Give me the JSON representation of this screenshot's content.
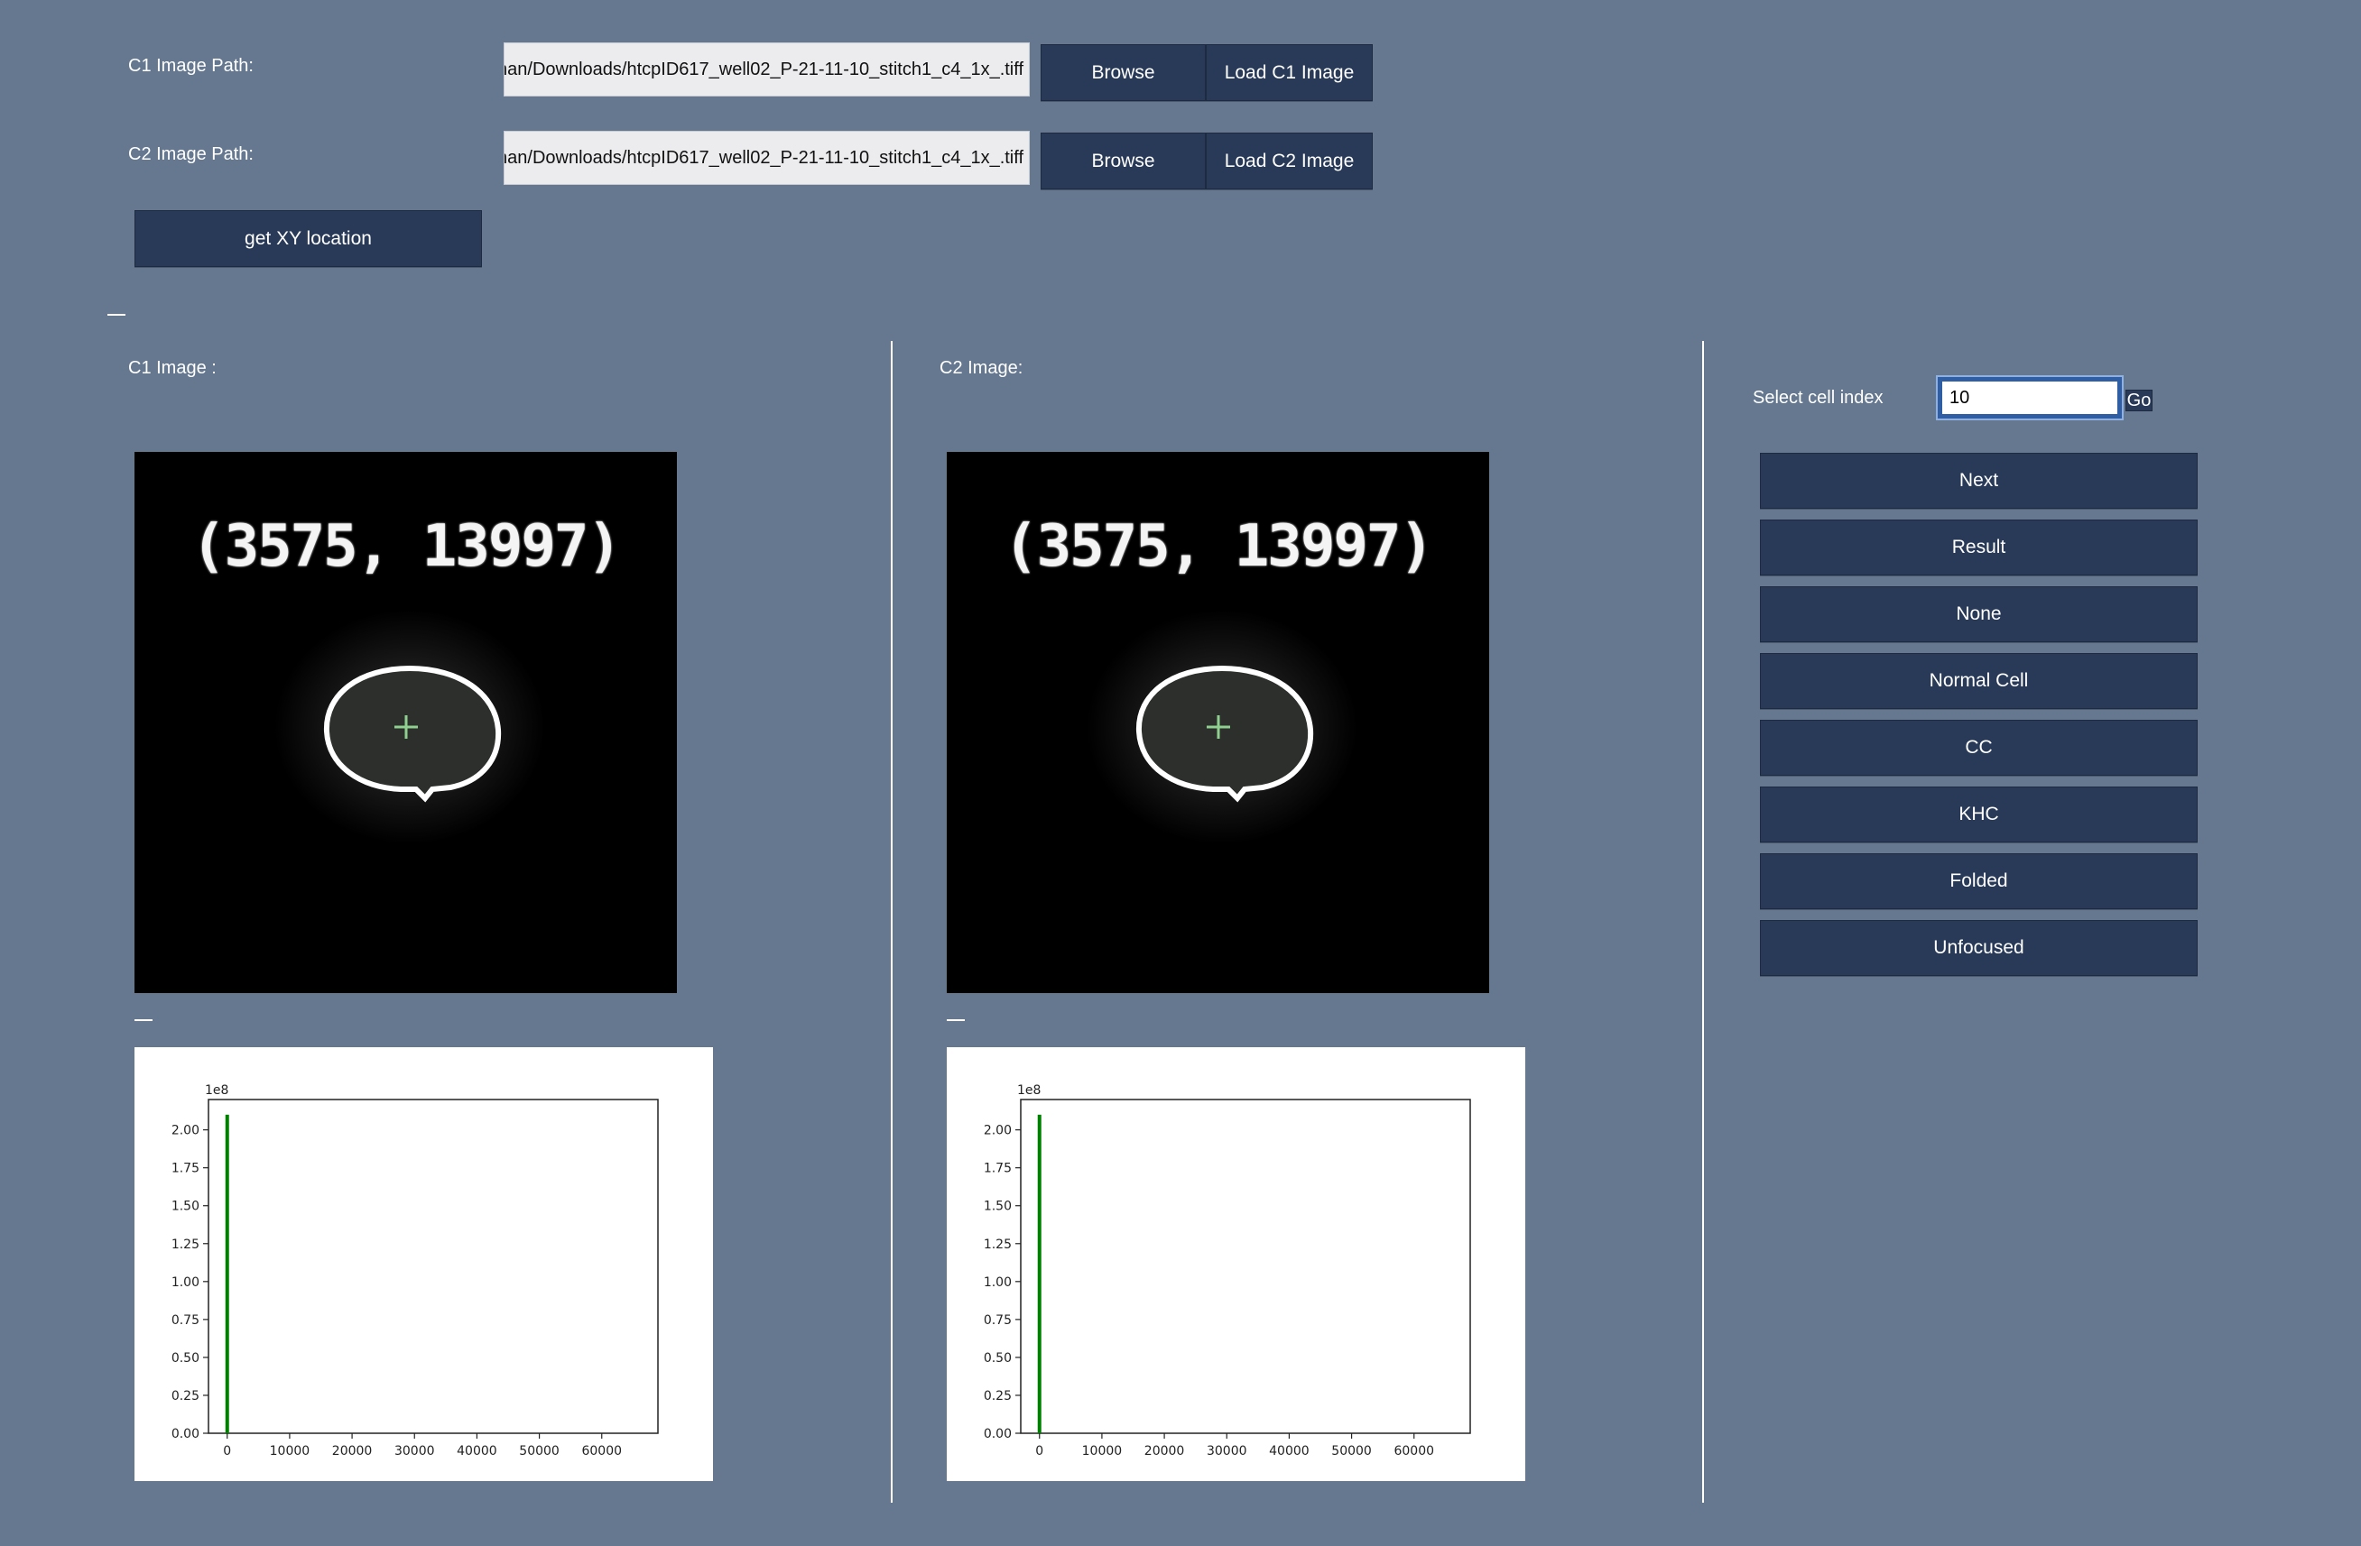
{
  "paths": {
    "c1_label": "C1 Image Path:",
    "c1_value": "nan/Downloads/htcpID617_well02_P-21-11-10_stitch1_c4_1x_.tiff",
    "c2_label": "C2 Image Path:",
    "c2_value": "nan/Downloads/htcpID617_well02_P-21-11-10_stitch1_c4_1x_.tiff",
    "browse_label": "Browse",
    "load_c1_label": "Load C1 Image",
    "load_c2_label": "Load C2 Image",
    "xy_button_label": "get XY location"
  },
  "viewers": {
    "c1_title": "C1 Image :",
    "c2_title": "C2 Image:",
    "coord_text": "(3575, 13997)"
  },
  "side_panel": {
    "select_label": "Select cell index",
    "index_value": "10",
    "go_label": "Go",
    "buttons": [
      "Next",
      "Result",
      "None",
      "Normal Cell",
      "CC",
      "KHC",
      "Folded",
      "Unfocused"
    ]
  },
  "chart_data": [
    {
      "type": "bar",
      "name": "c1-histogram",
      "title": "",
      "xlabel": "",
      "ylabel": "",
      "y_scale_label": "1e8",
      "xlim": [
        -3000,
        69000
      ],
      "ylim": [
        0,
        2.2
      ],
      "x_ticks": [
        "0",
        "10000",
        "20000",
        "30000",
        "40000",
        "50000",
        "60000"
      ],
      "y_ticks": [
        "0.00",
        "0.25",
        "0.50",
        "0.75",
        "1.00",
        "1.25",
        "1.50",
        "1.75",
        "2.00"
      ],
      "x": [
        0
      ],
      "values": [
        2.1
      ],
      "color": "#008000"
    },
    {
      "type": "bar",
      "name": "c2-histogram",
      "title": "",
      "xlabel": "",
      "ylabel": "",
      "y_scale_label": "1e8",
      "xlim": [
        -3000,
        69000
      ],
      "ylim": [
        0,
        2.2
      ],
      "x_ticks": [
        "0",
        "10000",
        "20000",
        "30000",
        "40000",
        "50000",
        "60000"
      ],
      "y_ticks": [
        "0.00",
        "0.25",
        "0.50",
        "0.75",
        "1.00",
        "1.25",
        "1.50",
        "1.75",
        "2.00"
      ],
      "x": [
        0
      ],
      "values": [
        2.1
      ],
      "color": "#008000"
    }
  ]
}
